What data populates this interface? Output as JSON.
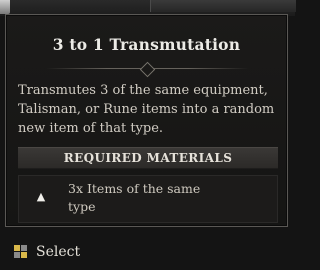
{
  "tooltip": {
    "title": "3 to 1 Transmutation",
    "description": "Transmutes 3 of the same equipment, Talisman, or Rune items into a random new item of that type.",
    "required_header": "REQUIRED MATERIALS",
    "requirements": [
      {
        "icon": "triangle-up-icon",
        "glyph": "▲",
        "text": "3x Items of the same type"
      }
    ]
  },
  "controls": {
    "select_icon": "gamepad-button-icon",
    "select_label": "Select"
  },
  "colors": {
    "panel_border": "#5a5855",
    "panel_bg": "#1b1a19",
    "header_bar": "#3a3836",
    "text_primary": "#ecebe6",
    "text_body": "#d2cdc4",
    "button_icon_yellow": "#d9b84a",
    "button_icon_grey": "#8a8a8a"
  }
}
